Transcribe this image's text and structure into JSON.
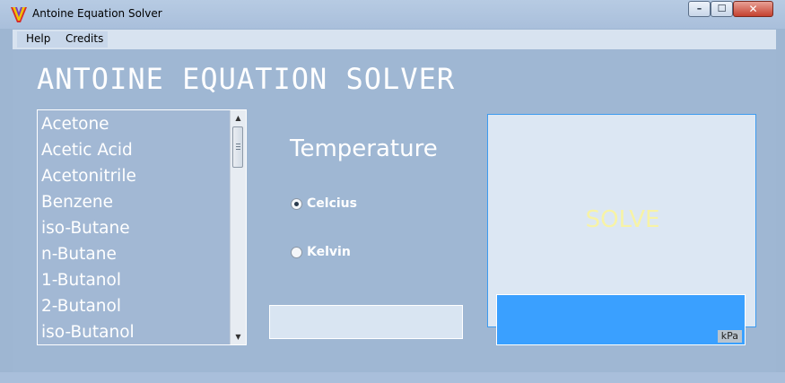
{
  "window": {
    "title": "Antoine Equation Solver",
    "controls": {
      "minimize": "–",
      "maximize": "☐",
      "close": "✕"
    }
  },
  "menu": {
    "items": [
      "Help",
      "Credits"
    ]
  },
  "heading": "ANTOINE EQUATION SOLVER",
  "compounds": {
    "items": [
      "Acetone",
      "Acetic Acid",
      "Acetonitrile",
      "Benzene",
      "iso-Butane",
      "n-Butane",
      "1-Butanol",
      "2-Butanol",
      "iso-Butanol"
    ],
    "scroll_up": "▲",
    "scroll_down": "▼"
  },
  "temperature": {
    "label": "Temperature",
    "options": [
      {
        "label": "Celcius",
        "selected": true
      },
      {
        "label": "Kelvin",
        "selected": false
      }
    ]
  },
  "temperature_input": {
    "value": ""
  },
  "solve": {
    "label": "SOLVE"
  },
  "result": {
    "value": "",
    "unit": "kPa"
  },
  "colors": {
    "accent": "#3aa0ff",
    "client_bg": "#9fb7d3",
    "solve_text": "#f7f3a6"
  }
}
